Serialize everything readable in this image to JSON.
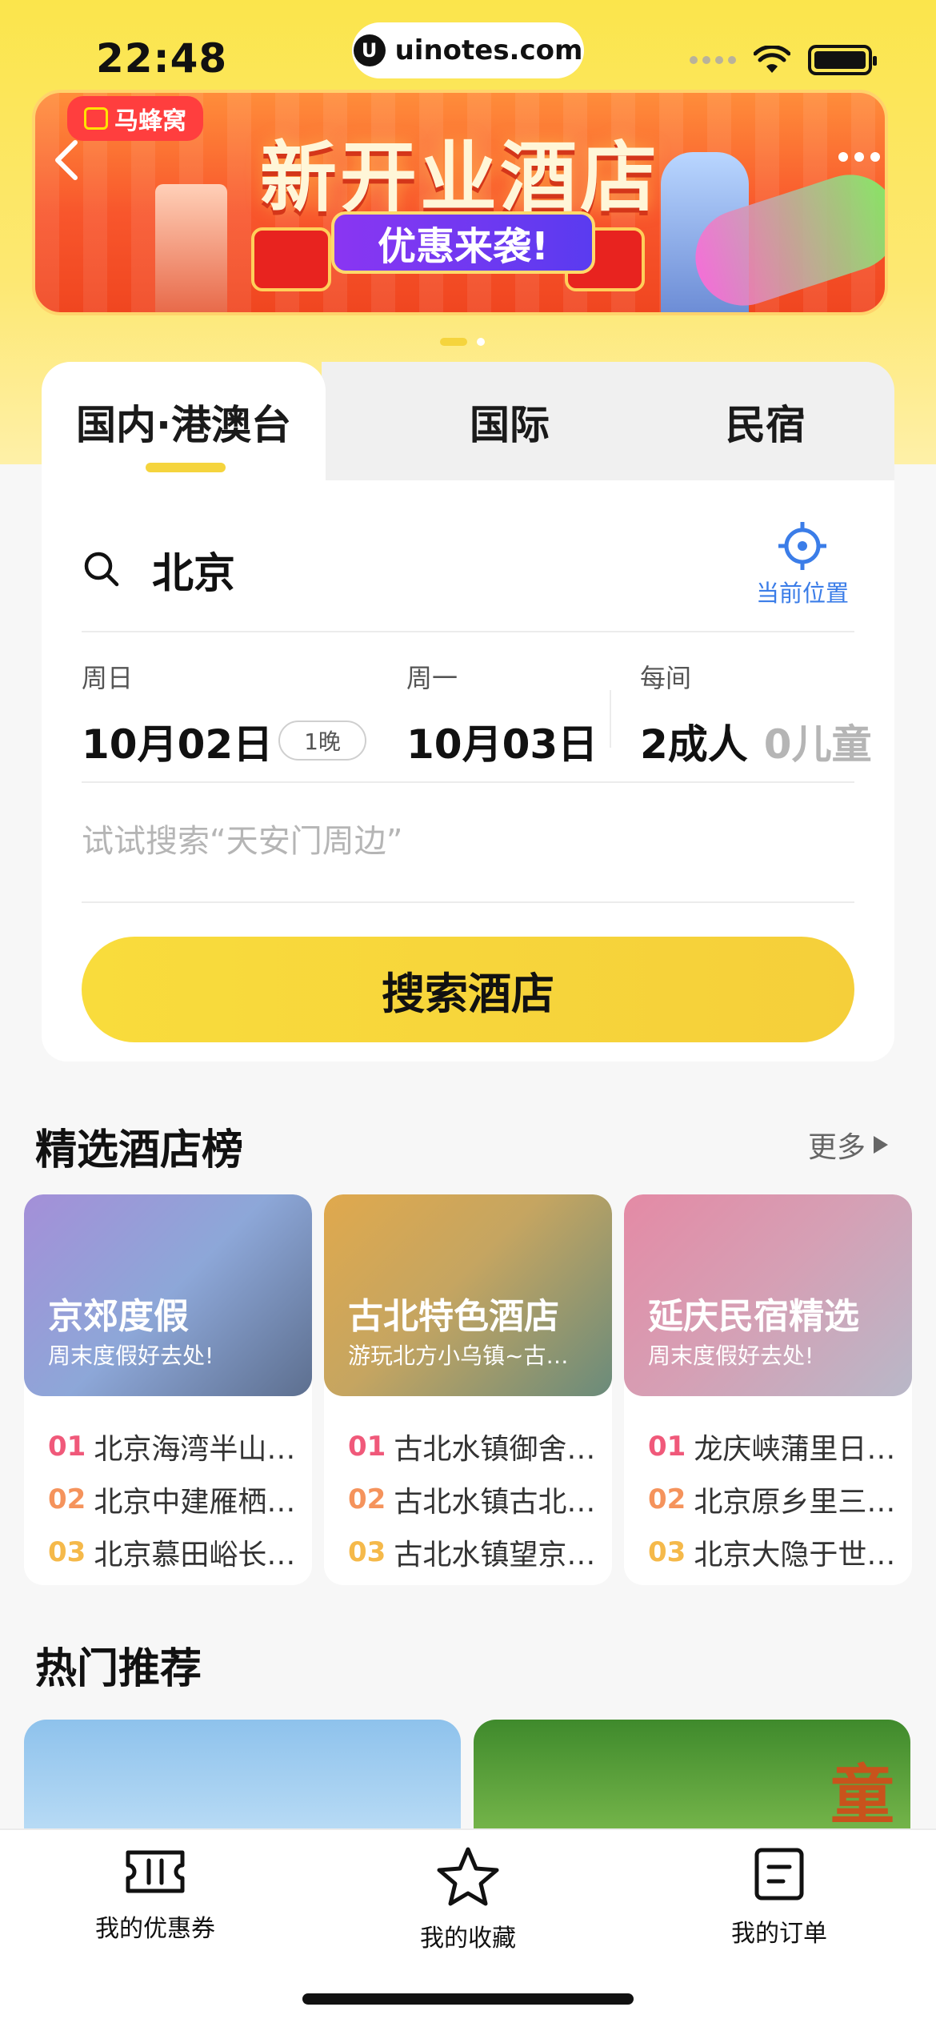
{
  "status_bar": {
    "time": "22:48",
    "url": "uinotes.com",
    "url_logo": "U"
  },
  "banner": {
    "brand": "马蜂窝",
    "title": "新开业酒店",
    "subtitle": "优惠来袭!",
    "page_count": 2,
    "active_page": 1
  },
  "tabs": [
    {
      "label": "国内·港澳台",
      "active": true
    },
    {
      "label": "国际",
      "active": false
    },
    {
      "label": "民宿",
      "active": false
    }
  ],
  "search": {
    "city": "北京",
    "locate_label": "当前位置",
    "checkin_week": "周日",
    "checkin_date": "10月02日",
    "nights": "1晚",
    "checkout_week": "周一",
    "checkout_date": "10月03日",
    "room_label": "每间",
    "adults": "2成人",
    "children": "0儿童",
    "hint": "试试搜索“天安门周边”",
    "button_label": "搜索酒店"
  },
  "rankings": {
    "title": "精选酒店榜",
    "more_label": "更多",
    "cards": [
      {
        "title": "京郊度假",
        "subtitle": "周末度假好去处!",
        "items": [
          {
            "num": "01",
            "name": "北京海湾半山…"
          },
          {
            "num": "02",
            "name": "北京中建雁栖…"
          },
          {
            "num": "03",
            "name": "北京慕田峪长…"
          }
        ]
      },
      {
        "title": "古北特色酒店",
        "subtitle": "游玩北方小乌镇~古…",
        "items": [
          {
            "num": "01",
            "name": "古北水镇御舍…"
          },
          {
            "num": "02",
            "name": "古北水镇古北…"
          },
          {
            "num": "03",
            "name": "古北水镇望京…"
          }
        ]
      },
      {
        "title": "延庆民宿精选",
        "subtitle": "周末度假好去处!",
        "items": [
          {
            "num": "01",
            "name": "龙庆峡蒲里日…"
          },
          {
            "num": "02",
            "name": "北京原乡里三…"
          },
          {
            "num": "03",
            "name": "北京大隐于世…"
          }
        ]
      }
    ]
  },
  "hot": {
    "title": "热门推荐",
    "card2_tag": "童"
  },
  "bottom_nav": [
    {
      "label": "我的优惠券",
      "icon": "ticket-icon"
    },
    {
      "label": "我的收藏",
      "icon": "star-icon"
    },
    {
      "label": "我的订单",
      "icon": "order-icon"
    }
  ],
  "colors": {
    "accent_yellow": "#f5d43d",
    "link_blue": "#3b7de8",
    "rank_1": "#f0597a",
    "rank_2": "#f5935c",
    "rank_3": "#f5b94a"
  }
}
